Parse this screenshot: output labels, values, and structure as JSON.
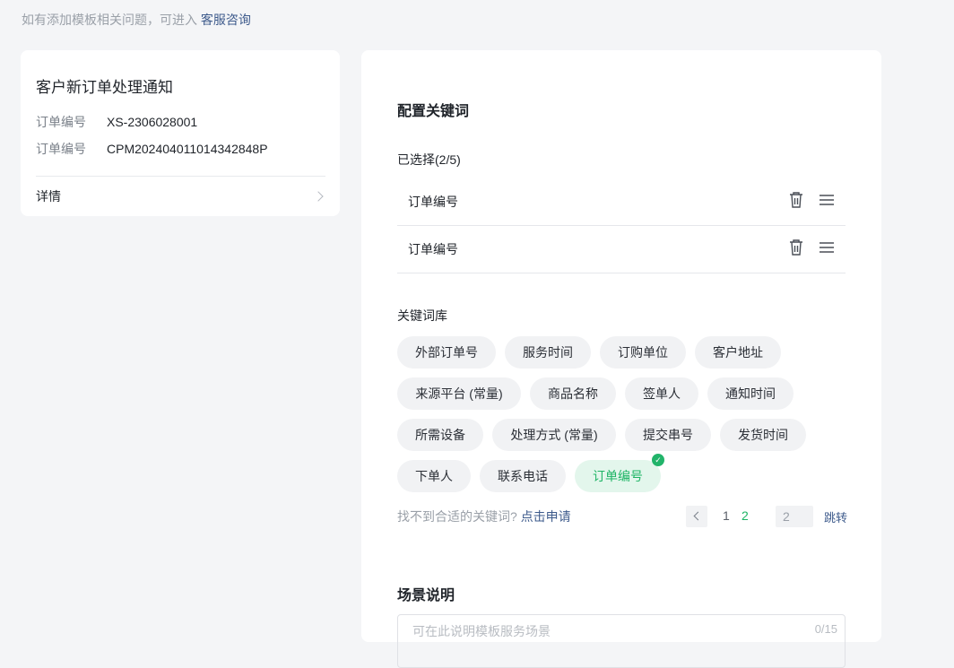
{
  "hint": {
    "text": "如有添加模板相关问题，可进入",
    "link": "客服咨询"
  },
  "preview": {
    "title": "客户新订单处理通知",
    "fields": [
      {
        "key": "订单编号",
        "value": "XS-2306028001"
      },
      {
        "key": "订单编号",
        "value": "CPM202404011014342848P"
      }
    ],
    "details_label": "详情"
  },
  "config": {
    "title": "配置关键词",
    "selected_header": "已选择(2/5)",
    "selected": [
      "订单编号",
      "订单编号"
    ],
    "library_header": "关键词库",
    "keywords": [
      "外部订单号",
      "服务时间",
      "订购单位",
      "客户地址",
      "来源平台 (常量)",
      "商品名称",
      "签单人",
      "通知时间",
      "所需设备",
      "处理方式 (常量)",
      "提交串号",
      "发货时间",
      "下单人",
      "联系电话",
      "订单编号"
    ],
    "active_keyword": "订单编号",
    "apply_text": "找不到合适的关键词?",
    "apply_link": "点击申请",
    "pagination": {
      "pages": [
        "1",
        "2"
      ],
      "current": "2",
      "jump_value": "2",
      "jump_label": "跳转"
    },
    "scene_title": "场景说明",
    "scene_placeholder": "可在此说明模板服务场景",
    "scene_count": "0/15"
  },
  "colors": {
    "accent_green": "#1eb465",
    "link_blue": "#3e5b8c"
  }
}
